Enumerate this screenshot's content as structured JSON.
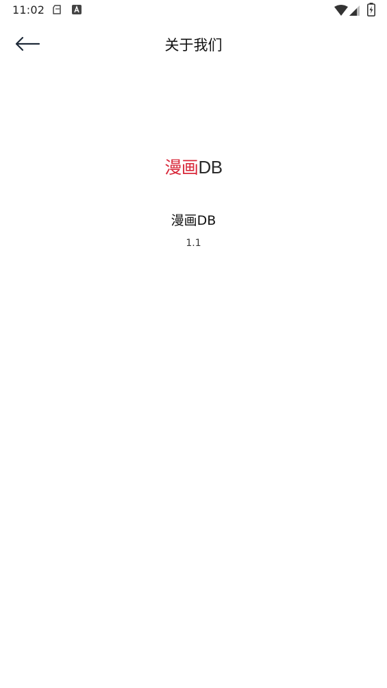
{
  "status_bar": {
    "time": "11:02",
    "icons": [
      "storage-notification-icon",
      "a-notification-icon",
      "wifi-icon",
      "cell-signal-icon",
      "battery-charging-icon"
    ]
  },
  "toolbar": {
    "back_icon": "arrow-left-icon",
    "title": "关于我们"
  },
  "about": {
    "logo_cn": "漫画",
    "logo_en": "DB",
    "app_name": "漫画DB",
    "version": "1.1"
  },
  "colors": {
    "background": "#ffffff",
    "logo_red": "#d8283a",
    "text_dark": "#111111"
  }
}
